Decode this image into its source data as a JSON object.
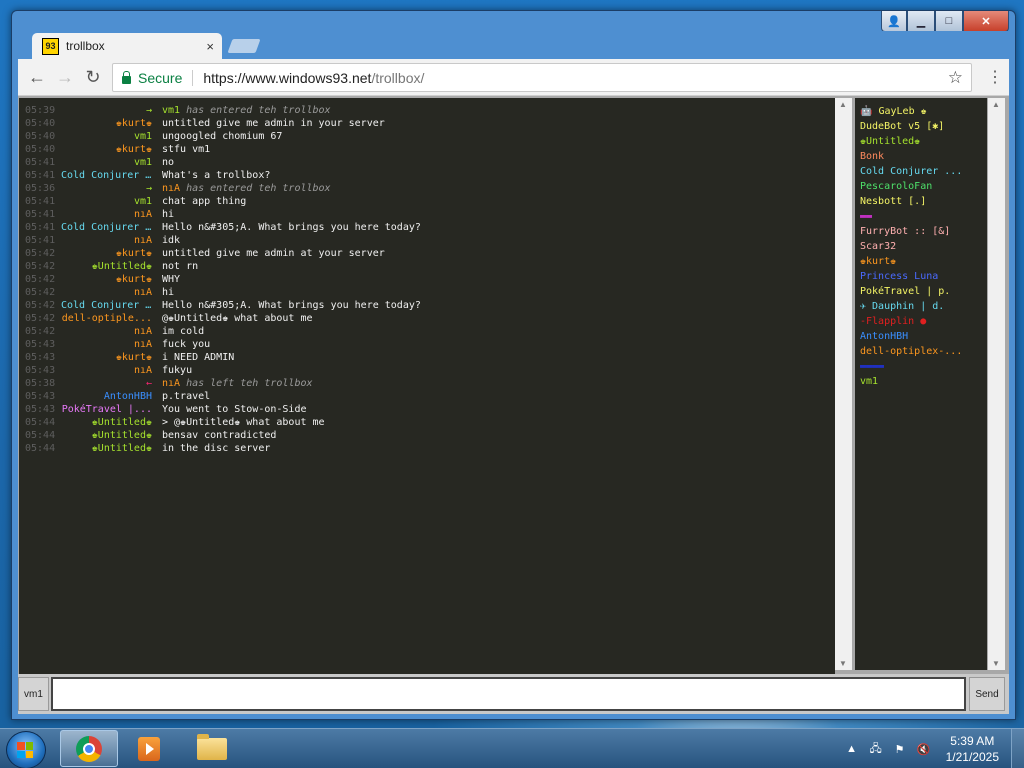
{
  "window": {
    "tab_title": "trollbox",
    "tab_close": "×",
    "secure_label": "Secure",
    "url_host": "https://www.windows93.net",
    "url_path": "/trollbox/"
  },
  "chat": {
    "messages": [
      {
        "time": "05:39",
        "nick": "→",
        "nick_color": "#a6e22e",
        "text": "vm1 has entered teh trollbox",
        "system": true,
        "text_nick": "vm1",
        "text_nick_color": "#a6e22e"
      },
      {
        "time": "05:40",
        "nick": "♚kurt♚",
        "nick_color": "#fd971f",
        "text": "untitled give me admin in your server"
      },
      {
        "time": "05:40",
        "nick": "vm1",
        "nick_color": "#a6e22e",
        "text": "ungoogled chomium 67"
      },
      {
        "time": "05:40",
        "nick": "♚kurt♚",
        "nick_color": "#fd971f",
        "text": "stfu vm1"
      },
      {
        "time": "05:41",
        "nick": "vm1",
        "nick_color": "#a6e22e",
        "text": "no"
      },
      {
        "time": "05:41",
        "nick": "Cold Conjurer ...",
        "nick_color": "#66d9ef",
        "text": "What's a trollbox?"
      },
      {
        "time": "05:36",
        "nick": "→",
        "nick_color": "#a6e22e",
        "text": "nıA has entered teh trollbox",
        "system": true,
        "text_nick": "nıA",
        "text_nick_color": "#fd971f"
      },
      {
        "time": "05:41",
        "nick": "vm1",
        "nick_color": "#a6e22e",
        "text": "chat app thing"
      },
      {
        "time": "05:41",
        "nick": "nıA",
        "nick_color": "#fd971f",
        "text": "hi"
      },
      {
        "time": "05:41",
        "nick": "Cold Conjurer ...",
        "nick_color": "#66d9ef",
        "text": "Hello n&#305;A. What brings you here today?"
      },
      {
        "time": "05:41",
        "nick": "nıA",
        "nick_color": "#fd971f",
        "text": "idk"
      },
      {
        "time": "05:42",
        "nick": "♚kurt♚",
        "nick_color": "#fd971f",
        "text": "untitled give me admin at your server"
      },
      {
        "time": "05:42",
        "nick": "♚Untitled♚",
        "nick_color": "#a6e22e",
        "text": "not rn"
      },
      {
        "time": "05:42",
        "nick": "♚kurt♚",
        "nick_color": "#fd971f",
        "text": "WHY"
      },
      {
        "time": "05:42",
        "nick": "nıA",
        "nick_color": "#fd971f",
        "text": "hi"
      },
      {
        "time": "05:42",
        "nick": "Cold Conjurer ...",
        "nick_color": "#66d9ef",
        "text": "Hello n&#305;A. What brings you here today?"
      },
      {
        "time": "05:42",
        "nick": "dell-optiple...",
        "nick_color": "#fd971f",
        "text": "@♚Untitled♚ what about me"
      },
      {
        "time": "05:42",
        "nick": "nıA",
        "nick_color": "#fd971f",
        "text": "im cold"
      },
      {
        "time": "05:43",
        "nick": "nıA",
        "nick_color": "#fd971f",
        "text": "fuck you"
      },
      {
        "time": "05:43",
        "nick": "♚kurt♚",
        "nick_color": "#fd971f",
        "text": "i NEED ADMIN"
      },
      {
        "time": "05:43",
        "nick": "nıA",
        "nick_color": "#fd971f",
        "text": "fukyu"
      },
      {
        "time": "05:38",
        "nick": "←",
        "nick_color": "#f92672",
        "text": "nıA has left teh trollbox",
        "system": true,
        "text_nick": "nıA",
        "text_nick_color": "#fd971f"
      },
      {
        "time": "05:43",
        "nick": "AntonHBH",
        "nick_color": "#3a8fff",
        "text": "p.travel"
      },
      {
        "time": "05:43",
        "nick": "PokéTravel |...",
        "nick_color": "#e879f9",
        "text": "You went to Stow-on-Side"
      },
      {
        "time": "05:44",
        "nick": "♚Untitled♚",
        "nick_color": "#a6e22e",
        "text": "> @♚Untitled♚ what about me"
      },
      {
        "time": "05:44",
        "nick": "♚Untitled♚",
        "nick_color": "#a6e22e",
        "text": "bensav contradicted"
      },
      {
        "time": "05:44",
        "nick": "♚Untitled♚",
        "nick_color": "#a6e22e",
        "text": "in the disc server"
      }
    ]
  },
  "users": [
    {
      "name": "🤖 GayLeb ♚",
      "color": "#f4f466"
    },
    {
      "name": "DudeBot v5 [✱]",
      "color": "#f4f466"
    },
    {
      "name": "♚Untitled♚",
      "color": "#a6e22e"
    },
    {
      "name": "Bonk",
      "color": "#fd8a5e"
    },
    {
      "name": "Cold Conjurer ...",
      "color": "#66d9ef"
    },
    {
      "name": "PescaroloFan",
      "color": "#4ee06a"
    },
    {
      "name": "Nesbott [.]",
      "color": "#f4f466"
    },
    {
      "name": "▬▬",
      "color": "#c030c0"
    },
    {
      "name": "FurryBot :: [&]",
      "color": "#ffb0b0"
    },
    {
      "name": "Scar32",
      "color": "#ffb0b0"
    },
    {
      "name": "♚kurt♚",
      "color": "#fd971f"
    },
    {
      "name": "Princess Luna",
      "color": "#4a6aff"
    },
    {
      "name": "PokéTravel | p.",
      "color": "#f4f466"
    },
    {
      "name": "✈ Dauphin | d.",
      "color": "#66d9ef"
    },
    {
      "name": "-Flapplin ●",
      "color": "#e02020"
    },
    {
      "name": "AntonHBH",
      "color": "#3a8fff"
    },
    {
      "name": "dell-optiplex-...",
      "color": "#fd971f"
    },
    {
      "name": "▬▬▬▬",
      "color": "#2030c0"
    },
    {
      "name": "vm1",
      "color": "#a6e22e"
    }
  ],
  "input": {
    "nick_label": "vm1",
    "text_value": "",
    "send_label": "Send"
  },
  "taskbar": {
    "time": "5:39 AM",
    "date": "1/21/2025"
  },
  "icons": [
    "user-icon",
    "minimize-icon",
    "maximize-icon",
    "close-icon",
    "back-icon",
    "forward-icon",
    "reload-icon",
    "lock-icon",
    "star-icon",
    "menu-icon",
    "windows-start-icon",
    "chrome-icon",
    "media-player-icon",
    "folder-icon",
    "network-icon",
    "flag-icon",
    "volume-muted-icon"
  ]
}
